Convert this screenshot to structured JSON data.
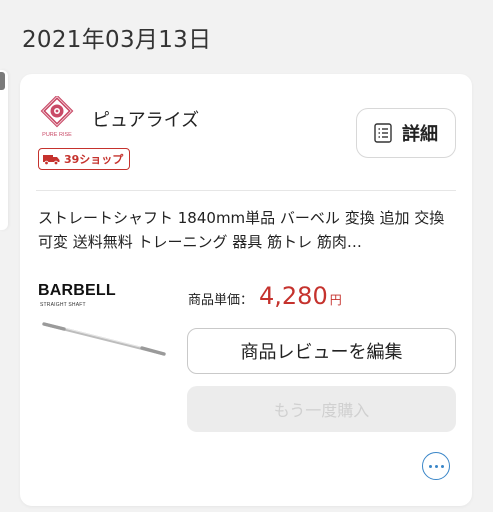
{
  "order": {
    "date": "2021年03月13日"
  },
  "shop": {
    "logo_text": "PURE RISE",
    "name": "ピュアライズ",
    "badge_label": "39ショップ",
    "brand_color": "#c5322d"
  },
  "actions": {
    "detail_label": "詳細",
    "detail_icon": "document-list-icon",
    "review_label": "商品レビューを編集",
    "rebuy_label": "もう一度購入",
    "more_icon": "more-horizontal-icon"
  },
  "product": {
    "title": "ストレートシャフト 1840mm単品 バーベル 変換 追加 交換 可変 送料無料 トレーニング 器具 筋トレ 筋肉…",
    "image_brand": "BARBELL",
    "image_subtitle": "STRAIGHT SHAFT",
    "price_label": "商品単価：",
    "price_value": "4,280",
    "price_unit": "円"
  }
}
